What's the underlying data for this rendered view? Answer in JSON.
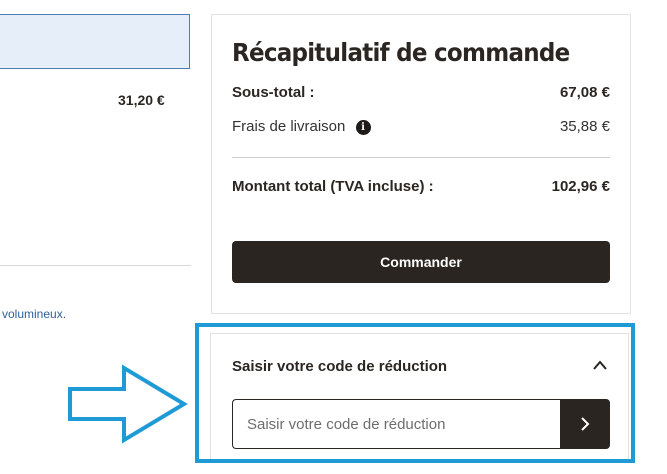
{
  "cart": {
    "item_price": "31,20 €",
    "note": "volumineux."
  },
  "summary": {
    "title": "Récapitulatif de commande",
    "subtotal_label": "Sous-total :",
    "subtotal_value": "67,08 €",
    "shipping_label": "Frais de livraison",
    "shipping_value": "35,88 €",
    "total_label": "Montant total (TVA incluse) :",
    "total_value": "102,96 €",
    "order_button": "Commander"
  },
  "discount": {
    "title": "Saisir votre code de réduction",
    "placeholder": "Saisir votre code de réduction"
  },
  "icons": {
    "info": "info-icon",
    "chevron_up": "chevron-up-icon",
    "chevron_right": "chevron-right-icon",
    "annotation_arrow": "arrow-right-outline-icon"
  },
  "colors": {
    "highlight": "#1e9ad5",
    "button_bg": "#2a2521",
    "link": "#2f5f9b"
  }
}
